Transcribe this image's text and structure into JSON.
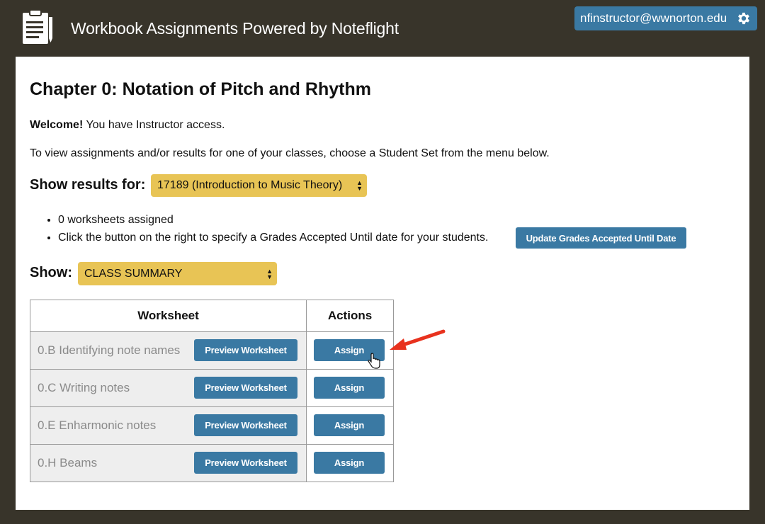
{
  "header": {
    "app_title": "Workbook Assignments Powered by Noteflight",
    "user_email": "nfinstructor@wwnorton.edu",
    "app_icon": "clipboard-icon",
    "settings_icon": "gear-icon"
  },
  "page": {
    "title": "Chapter 0: Notation of Pitch and Rhythm",
    "welcome_bold": "Welcome!",
    "welcome_text": " You have Instructor access.",
    "instructions": "To view assignments and/or results for one of your classes, choose a Student Set from the menu below.",
    "results_label": "Show results for:",
    "student_set_selected": "17189 (Introduction to Music Theory)",
    "bullet_1": "0 worksheets assigned",
    "bullet_2": "Click the button on the right to specify a Grades Accepted Until date for your students.",
    "update_button": "Update Grades Accepted Until Date",
    "show_label": "Show:",
    "show_selected": "CLASS SUMMARY"
  },
  "table": {
    "headers": {
      "worksheet": "Worksheet",
      "actions": "Actions"
    },
    "preview_label": "Preview Worksheet",
    "assign_label": "Assign",
    "rows": [
      {
        "name": "0.B Identifying note names"
      },
      {
        "name": "0.C Writing notes"
      },
      {
        "name": "0.E Enharmonic notes"
      },
      {
        "name": "0.H Beams"
      }
    ]
  },
  "colors": {
    "background": "#38342a",
    "accent_blue": "#3a79a3",
    "select_yellow": "#e8c455",
    "annotation_arrow": "#e8321e"
  }
}
